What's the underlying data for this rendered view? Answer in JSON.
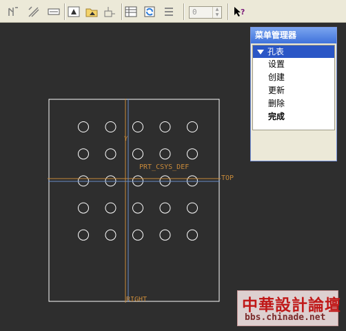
{
  "toolbar": {
    "buttons": [
      {
        "name": "dimension-icon"
      },
      {
        "name": "ordinate-dimension-icon"
      },
      {
        "name": "note-icon"
      },
      {
        "name": "surface-finish-icon"
      },
      {
        "name": "datum-target-icon"
      },
      {
        "name": "folder-datum-icon"
      },
      {
        "name": "balloon-icon"
      },
      {
        "name": "table-icon"
      },
      {
        "name": "regenerate-icon"
      },
      {
        "name": "repeat-region-icon"
      },
      {
        "name": "whats-this-help-icon"
      }
    ],
    "spin_value": "0"
  },
  "drawing": {
    "csys_label": "PRT_CSYS_DEF",
    "top_label": "TOP",
    "right_label": "RIGHT",
    "colors": {
      "background": "#2e2e2e",
      "geometry": "#ffffff",
      "datum": "#c88a3a",
      "axis": "#6a8fc9"
    },
    "hole_grid": {
      "rows": 5,
      "columns": 5
    }
  },
  "menu_manager": {
    "title": "菜单管理器",
    "section": "孔表",
    "items": [
      "设置",
      "创建",
      "更新",
      "删除",
      "完成"
    ]
  },
  "watermark": {
    "title": "中華設計論壇",
    "url": "bbs.chinade.net"
  }
}
